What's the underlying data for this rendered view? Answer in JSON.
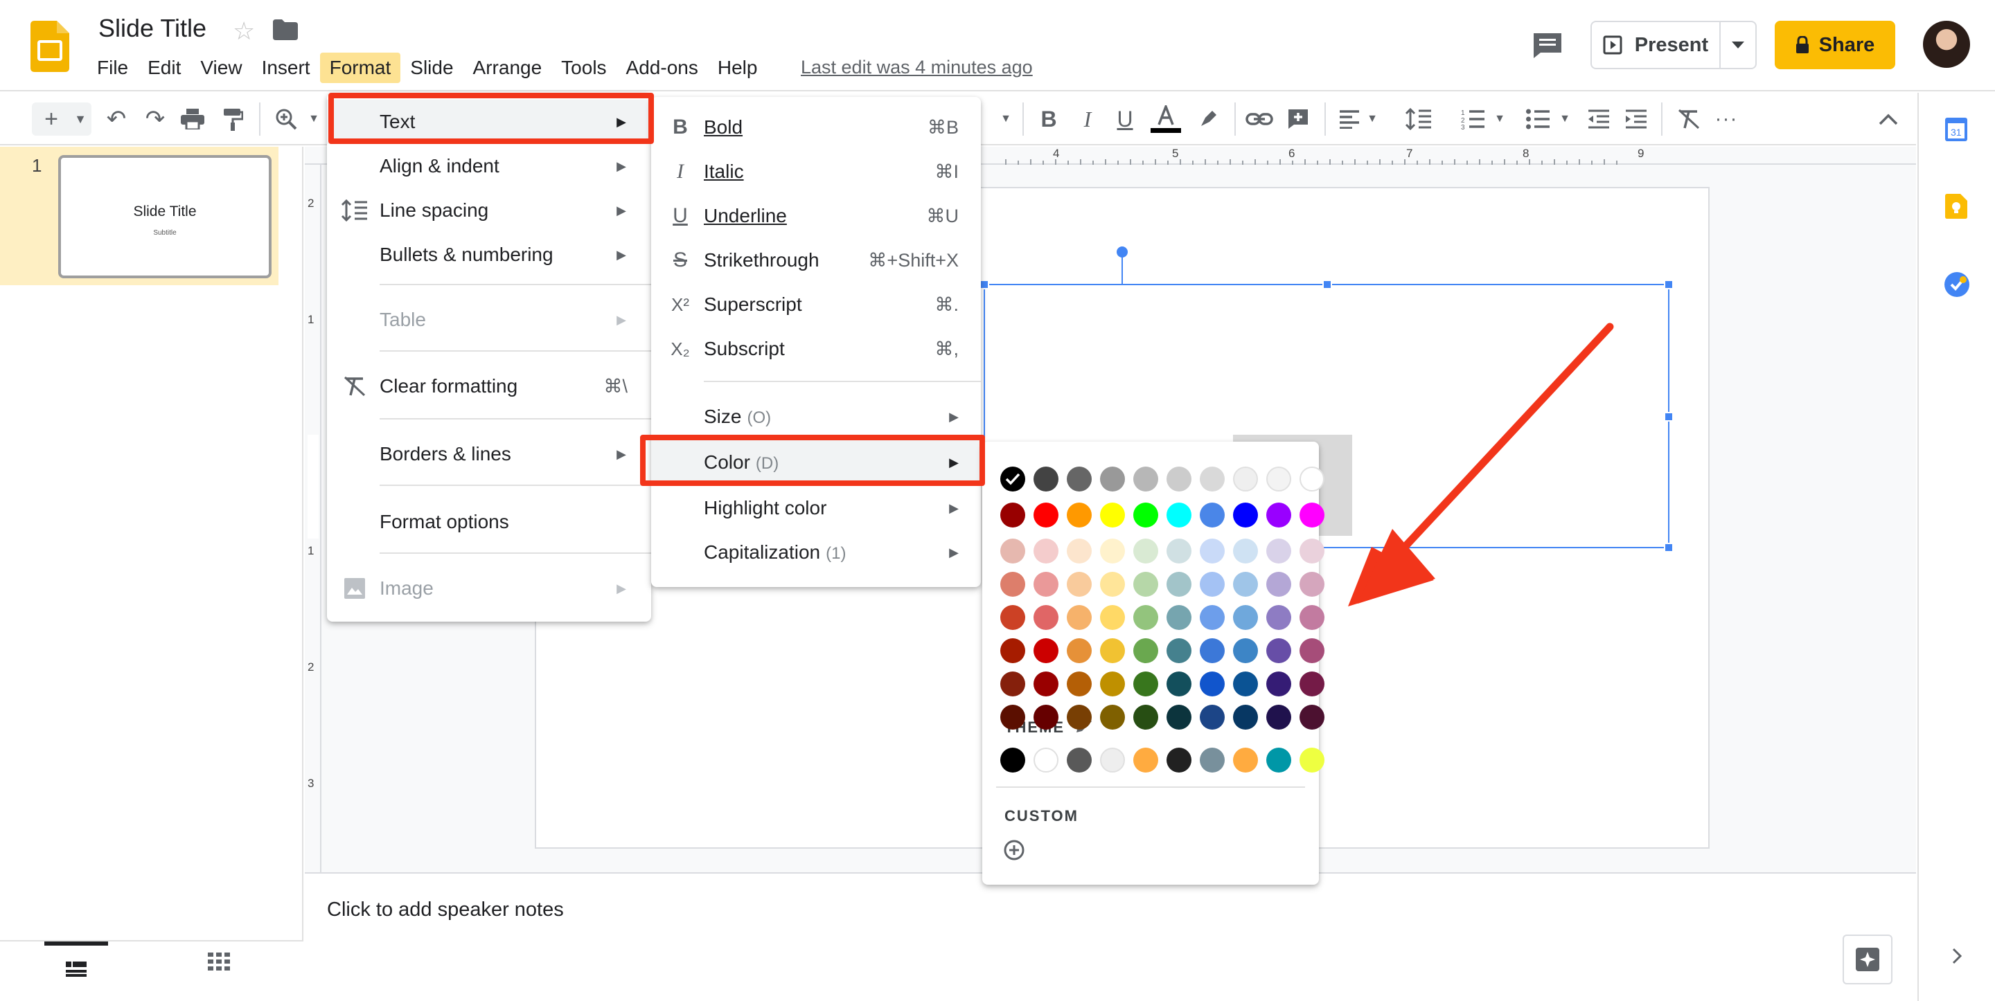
{
  "app": {
    "doc_title": "Slide Title",
    "last_edit": "Last edit was 4 minutes ago",
    "menubar": [
      "File",
      "Edit",
      "View",
      "Insert",
      "Format",
      "Slide",
      "Arrange",
      "Tools",
      "Add-ons",
      "Help"
    ],
    "active_menu": "Format",
    "present_label": "Present",
    "share_label": "Share"
  },
  "ruler": {
    "h_numbers": [
      "4",
      "5",
      "6",
      "7",
      "8",
      "9"
    ],
    "v_numbers": [
      "2",
      "1",
      "1",
      "2",
      "3"
    ]
  },
  "filmstrip": {
    "slide_number": "1",
    "thumb_title": "Slide Title",
    "thumb_subtitle": "Subtitle"
  },
  "notes": {
    "placeholder": "Click to add speaker notes"
  },
  "format_menu": {
    "items": [
      {
        "label": "Text",
        "arrow": "▶",
        "highlighted": true
      },
      {
        "label": "Align & indent",
        "arrow": "▶"
      },
      {
        "label": "Line spacing",
        "arrow": "▶"
      },
      {
        "label": "Bullets & numbering",
        "arrow": "▶"
      },
      {
        "label": "Table",
        "arrow": "▶",
        "disabled": true
      },
      {
        "label": "Clear formatting",
        "shortcut": "⌘\\"
      },
      {
        "label": "Borders & lines",
        "arrow": "▶"
      },
      {
        "label": "Format options"
      },
      {
        "label": "Image",
        "arrow": "▶",
        "disabled": true
      }
    ]
  },
  "text_menu": {
    "items": [
      {
        "label": "Bold",
        "shortcut": "⌘B",
        "icon": "B"
      },
      {
        "label": "Italic",
        "shortcut": "⌘I",
        "icon": "I"
      },
      {
        "label": "Underline",
        "shortcut": "⌘U",
        "icon": "U"
      },
      {
        "label": "Strikethrough",
        "shortcut": "⌘+Shift+X",
        "icon": "S"
      },
      {
        "label": "Superscript",
        "shortcut": "⌘.",
        "icon": "X²"
      },
      {
        "label": "Subscript",
        "shortcut": "⌘,",
        "icon": "X₂"
      },
      {
        "label": "Size",
        "mnemonic": "(O)",
        "arrow": "▶"
      },
      {
        "label": "Color",
        "mnemonic": "(D)",
        "arrow": "▶",
        "highlighted": true
      },
      {
        "label": "Highlight color",
        "arrow": "▶"
      },
      {
        "label": "Capitalization",
        "mnemonic": "(1)",
        "arrow": "▶"
      }
    ]
  },
  "color_panel": {
    "theme_label": "THEME",
    "custom_label": "CUSTOM",
    "selected_color": "#000000",
    "grid": [
      [
        "#000000",
        "#434343",
        "#666666",
        "#999999",
        "#b7b7b7",
        "#cccccc",
        "#d9d9d9",
        "#efefef",
        "#f3f3f3",
        "#ffffff"
      ],
      [
        "#980000",
        "#ff0000",
        "#ff9900",
        "#ffff00",
        "#00ff00",
        "#00ffff",
        "#4a86e8",
        "#0000ff",
        "#9900ff",
        "#ff00ff"
      ],
      [
        "#e6b8af",
        "#f4cccc",
        "#fce5cd",
        "#fff2cc",
        "#d9ead3",
        "#d0e0e3",
        "#c9daf8",
        "#cfe2f3",
        "#d9d2e9",
        "#ead1dc"
      ],
      [
        "#dd7e6b",
        "#ea9999",
        "#f9cb9c",
        "#ffe599",
        "#b6d7a8",
        "#a2c4c9",
        "#a4c2f4",
        "#9fc5e8",
        "#b4a7d6",
        "#d5a6bd"
      ],
      [
        "#cc4125",
        "#e06666",
        "#f6b26b",
        "#ffd966",
        "#93c47d",
        "#76a5af",
        "#6d9eeb",
        "#6fa8dc",
        "#8e7cc3",
        "#c27ba0"
      ],
      [
        "#a61c00",
        "#cc0000",
        "#e69138",
        "#f1c232",
        "#6aa84f",
        "#45818e",
        "#3c78d8",
        "#3d85c6",
        "#674ea7",
        "#a64d79"
      ],
      [
        "#85200c",
        "#990000",
        "#b45f06",
        "#bf9000",
        "#38761d",
        "#134f5c",
        "#1155cc",
        "#0b5394",
        "#351c75",
        "#741b47"
      ],
      [
        "#5b0f00",
        "#660000",
        "#783f04",
        "#7f6000",
        "#274e13",
        "#0c343d",
        "#1c4587",
        "#073763",
        "#20124d",
        "#4c1130"
      ]
    ],
    "theme_colors": [
      "#000000",
      "#ffffff",
      "#595959",
      "#eeeeee",
      "#ffab40",
      "#212121",
      "#78909c",
      "#ffab40",
      "#0097a7",
      "#eeff41"
    ]
  },
  "colors": {
    "accent": "#fbbc04",
    "selection": "#4285f4",
    "annotation_red": "#f2351a"
  }
}
